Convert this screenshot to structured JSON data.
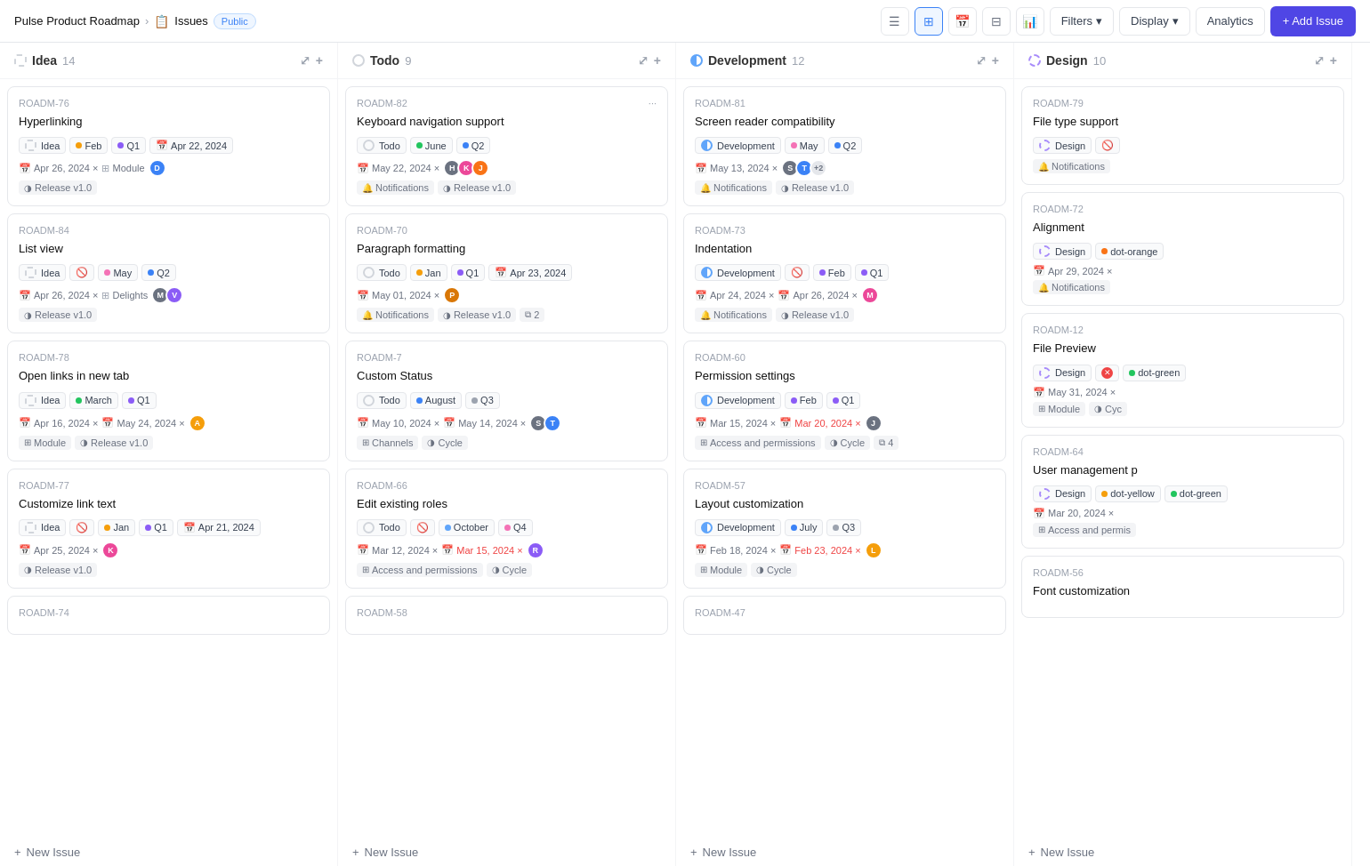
{
  "app": {
    "name": "Pulse Product Roadmap",
    "section": "Issues",
    "visibility": "Public"
  },
  "header": {
    "filters_label": "Filters",
    "display_label": "Display",
    "analytics_label": "Analytics",
    "add_issue_label": "+ Add Issue"
  },
  "columns": [
    {
      "id": "idea",
      "label": "Idea",
      "count": 14,
      "status_type": "idea",
      "cards": [
        {
          "id": "ROADM-76",
          "title": "Hyperlinking",
          "tags": [
            {
              "label": "Idea",
              "type": "status-idea"
            },
            {
              "label": "Feb",
              "dot": "#f59e0b"
            },
            {
              "label": "Q1",
              "dot": "#8b5cf6"
            },
            {
              "label": "Apr 22, 2024",
              "icon": "cal"
            }
          ],
          "meta": [
            {
              "text": "Apr 26, 2024 ×",
              "icon": "cal"
            },
            {
              "text": "Module",
              "icon": "mod"
            }
          ],
          "footer": [
            {
              "text": "Release v1.0",
              "icon": "cycle"
            }
          ],
          "avatars": [
            {
              "bg": "#3b82f6",
              "letter": "D"
            }
          ]
        },
        {
          "id": "ROADM-84",
          "title": "List view",
          "tags": [
            {
              "label": "Idea",
              "type": "status-idea"
            },
            {
              "label": "blocked",
              "icon": "block"
            },
            {
              "label": "May",
              "dot": "#f472b6"
            },
            {
              "label": "Q2",
              "dot": "#3b82f6"
            }
          ],
          "meta": [
            {
              "text": "Apr 26, 2024 ×",
              "icon": "cal"
            },
            {
              "text": "Delights",
              "icon": "mod"
            }
          ],
          "footer": [
            {
              "text": "Release v1.0",
              "icon": "cycle"
            }
          ],
          "avatars": [
            {
              "bg": "#6b7280",
              "letter": "M"
            },
            {
              "bg": "#8b5cf6",
              "letter": "V"
            }
          ]
        },
        {
          "id": "ROADM-78",
          "title": "Open links in new tab",
          "tags": [
            {
              "label": "Idea",
              "type": "status-idea"
            },
            {
              "label": "March",
              "dot": "#22c55e"
            },
            {
              "label": "Q1",
              "dot": "#8b5cf6"
            }
          ],
          "meta": [
            {
              "text": "Apr 16, 2024 ×",
              "icon": "cal"
            },
            {
              "text": "May 24, 2024 ×",
              "icon": "cal2"
            }
          ],
          "footer": [
            {
              "text": "Module",
              "icon": "mod"
            },
            {
              "text": "Release v1.0",
              "icon": "cycle"
            }
          ],
          "avatars": [
            {
              "bg": "#f59e0b",
              "letter": "A"
            }
          ]
        },
        {
          "id": "ROADM-77",
          "title": "Customize link text",
          "tags": [
            {
              "label": "Idea",
              "type": "status-idea"
            },
            {
              "label": "blocked",
              "icon": "block"
            },
            {
              "label": "Jan",
              "dot": "#f59e0b"
            },
            {
              "label": "Q1",
              "dot": "#8b5cf6"
            },
            {
              "label": "Apr 21, 2024",
              "icon": "cal"
            }
          ],
          "meta": [
            {
              "text": "Apr 25, 2024 ×",
              "icon": "cal"
            }
          ],
          "footer": [
            {
              "text": "Release v1.0",
              "icon": "cycle"
            }
          ],
          "avatars": [
            {
              "bg": "#ec4899",
              "letter": "K"
            }
          ]
        },
        {
          "id": "ROADM-74",
          "title": "",
          "tags": [],
          "meta": [],
          "footer": [],
          "avatars": []
        }
      ]
    },
    {
      "id": "todo",
      "label": "Todo",
      "count": 9,
      "status_type": "todo",
      "cards": [
        {
          "id": "ROADM-82",
          "title": "Keyboard navigation support",
          "tags": [
            {
              "label": "Todo",
              "type": "status-todo"
            },
            {
              "label": "June",
              "dot": "#22c55e"
            },
            {
              "label": "Q2",
              "dot": "#3b82f6"
            }
          ],
          "meta": [
            {
              "text": "May 22, 2024 ×",
              "icon": "cal"
            }
          ],
          "footer": [
            {
              "text": "Notifications",
              "icon": "notif"
            },
            {
              "text": "Release v1.0",
              "icon": "cycle"
            }
          ],
          "avatars": [
            {
              "bg": "#6b7280",
              "letter": "H"
            },
            {
              "bg": "#ec4899",
              "letter": "K"
            },
            {
              "bg": "#f97316",
              "letter": "J"
            }
          ]
        },
        {
          "id": "ROADM-70",
          "title": "Paragraph formatting",
          "tags": [
            {
              "label": "Todo",
              "type": "status-todo"
            },
            {
              "label": "Jan",
              "dot": "#f59e0b"
            },
            {
              "label": "Q1",
              "dot": "#8b5cf6"
            },
            {
              "label": "Apr 23, 2024",
              "icon": "cal"
            }
          ],
          "meta": [
            {
              "text": "May 01, 2024 ×",
              "icon": "cal"
            }
          ],
          "footer": [
            {
              "text": "Notifications",
              "icon": "notif"
            },
            {
              "text": "Release v1.0",
              "icon": "cycle"
            },
            {
              "text": "2",
              "icon": "layers"
            }
          ],
          "avatars": [
            {
              "bg": "#d97706",
              "letter": "P"
            }
          ]
        },
        {
          "id": "ROADM-7",
          "title": "Custom Status",
          "tags": [
            {
              "label": "Todo",
              "type": "status-todo"
            },
            {
              "label": "August",
              "dot": "#3b82f6"
            },
            {
              "label": "Q3",
              "dot": "#9ca3af"
            }
          ],
          "meta": [
            {
              "text": "May 10, 2024 ×",
              "icon": "cal"
            },
            {
              "text": "May 14, 2024 ×",
              "icon": "cal2"
            }
          ],
          "footer": [
            {
              "text": "Channels",
              "icon": "mod"
            },
            {
              "text": "Cycle",
              "icon": "cycle"
            }
          ],
          "avatars": [
            {
              "bg": "#6b7280",
              "letter": "S"
            },
            {
              "bg": "#3b82f6",
              "letter": "T"
            }
          ]
        },
        {
          "id": "ROADM-66",
          "title": "Edit existing roles",
          "tags": [
            {
              "label": "Todo",
              "type": "status-todo"
            },
            {
              "label": "blocked",
              "icon": "block"
            },
            {
              "label": "October",
              "dot": "#60a5fa"
            },
            {
              "label": "Q4",
              "dot": "#f472b6"
            }
          ],
          "meta": [
            {
              "text": "Mar 12, 2024 ×",
              "icon": "cal"
            },
            {
              "text": "Mar 15, 2024 ×",
              "icon": "cal2",
              "red": true
            }
          ],
          "footer": [
            {
              "text": "Access and permissions",
              "icon": "mod"
            },
            {
              "text": "Cycle",
              "icon": "cycle"
            }
          ],
          "avatars": [
            {
              "bg": "#8b5cf6",
              "letter": "R"
            }
          ]
        },
        {
          "id": "ROADM-58",
          "title": "",
          "tags": [],
          "meta": [],
          "footer": [],
          "avatars": []
        }
      ]
    },
    {
      "id": "development",
      "label": "Development",
      "count": 12,
      "status_type": "dev",
      "cards": [
        {
          "id": "ROADM-81",
          "title": "Screen reader compatibility",
          "tags": [
            {
              "label": "Development",
              "type": "status-dev"
            },
            {
              "label": "May",
              "dot": "#f472b6"
            },
            {
              "label": "Q2",
              "dot": "#3b82f6"
            }
          ],
          "meta": [
            {
              "text": "May 13, 2024 ×",
              "icon": "cal"
            }
          ],
          "footer": [
            {
              "text": "Notifications",
              "icon": "notif"
            },
            {
              "text": "Release v1.0",
              "icon": "cycle"
            }
          ],
          "avatars": [
            {
              "bg": "#6b7280",
              "letter": "S"
            },
            {
              "bg": "#3b82f6",
              "letter": "T"
            },
            {
              "count": "+2"
            }
          ]
        },
        {
          "id": "ROADM-73",
          "title": "Indentation",
          "tags": [
            {
              "label": "Development",
              "type": "status-dev"
            },
            {
              "label": "blocked",
              "icon": "block"
            },
            {
              "label": "Feb",
              "dot": "#8b5cf6"
            },
            {
              "label": "Q1",
              "dot": "#8b5cf6"
            }
          ],
          "meta": [
            {
              "text": "Apr 24, 2024 ×",
              "icon": "cal"
            },
            {
              "text": "Apr 26, 2024 ×",
              "icon": "cal2"
            }
          ],
          "footer": [
            {
              "text": "Notifications",
              "icon": "notif"
            },
            {
              "text": "Release v1.0",
              "icon": "cycle"
            }
          ],
          "avatars": [
            {
              "bg": "#ec4899",
              "letter": "M"
            }
          ]
        },
        {
          "id": "ROADM-60",
          "title": "Permission settings",
          "tags": [
            {
              "label": "Development",
              "type": "status-dev"
            },
            {
              "label": "Feb",
              "dot": "#8b5cf6"
            },
            {
              "label": "Q1",
              "dot": "#8b5cf6"
            }
          ],
          "meta": [
            {
              "text": "Mar 15, 2024 ×",
              "icon": "cal"
            },
            {
              "text": "Mar 20, 2024 ×",
              "icon": "cal2",
              "red": true
            }
          ],
          "footer": [
            {
              "text": "Access and permissions",
              "icon": "mod"
            },
            {
              "text": "Cycle",
              "icon": "cycle"
            },
            {
              "text": "4",
              "icon": "layers"
            }
          ],
          "avatars": [
            {
              "bg": "#6b7280",
              "letter": "J"
            }
          ]
        },
        {
          "id": "ROADM-57",
          "title": "Layout customization",
          "tags": [
            {
              "label": "Development",
              "type": "status-dev"
            },
            {
              "label": "July",
              "dot": "#3b82f6"
            },
            {
              "label": "Q3",
              "dot": "#9ca3af"
            }
          ],
          "meta": [
            {
              "text": "Feb 18, 2024 ×",
              "icon": "cal"
            },
            {
              "text": "Feb 23, 2024 ×",
              "icon": "cal2",
              "red": true
            }
          ],
          "footer": [
            {
              "text": "Module",
              "icon": "mod"
            },
            {
              "text": "Cycle",
              "icon": "cycle"
            }
          ],
          "avatars": [
            {
              "bg": "#f59e0b",
              "letter": "L"
            }
          ]
        },
        {
          "id": "ROADM-47",
          "title": "",
          "tags": [],
          "meta": [],
          "footer": [],
          "avatars": []
        }
      ]
    },
    {
      "id": "design",
      "label": "Design",
      "count": 10,
      "status_type": "design",
      "cards": [
        {
          "id": "ROADM-79",
          "title": "File type support",
          "tags": [
            {
              "label": "Design",
              "type": "status-design"
            },
            {
              "label": "blocked",
              "icon": "block"
            }
          ],
          "meta": [],
          "footer": [
            {
              "text": "Notifications",
              "icon": "notif"
            }
          ],
          "avatars": []
        },
        {
          "id": "ROADM-72",
          "title": "Alignment",
          "tags": [
            {
              "label": "Design",
              "type": "status-design"
            },
            {
              "label": "dot-orange",
              "dot": "#f97316"
            }
          ],
          "meta": [
            {
              "text": "Apr 29, 2024 ×",
              "icon": "cal"
            }
          ],
          "footer": [
            {
              "text": "Notifications",
              "icon": "notif"
            }
          ],
          "avatars": []
        },
        {
          "id": "ROADM-12",
          "title": "File Preview",
          "tags": [
            {
              "label": "Design",
              "type": "status-design"
            },
            {
              "label": "blocked-red",
              "icon": "block-red"
            },
            {
              "label": "dot-green",
              "dot": "#22c55e"
            }
          ],
          "meta": [
            {
              "text": "May 31, 2024 ×",
              "icon": "cal"
            }
          ],
          "footer": [
            {
              "text": "Module",
              "icon": "mod"
            },
            {
              "text": "Cyc",
              "icon": "cycle"
            }
          ],
          "avatars": []
        },
        {
          "id": "ROADM-64",
          "title": "User management p",
          "tags": [
            {
              "label": "Design",
              "type": "status-design"
            },
            {
              "label": "dot-yellow",
              "dot": "#f59e0b"
            },
            {
              "label": "dot-green",
              "dot": "#22c55e"
            }
          ],
          "meta": [
            {
              "text": "Mar 20, 2024 ×",
              "icon": "cal"
            }
          ],
          "footer": [
            {
              "text": "Access and permis",
              "icon": "mod"
            }
          ],
          "avatars": []
        },
        {
          "id": "ROADM-56",
          "title": "Font customization",
          "tags": [],
          "meta": [],
          "footer": [],
          "avatars": []
        }
      ]
    }
  ],
  "new_issue_label": "+ New Issue"
}
